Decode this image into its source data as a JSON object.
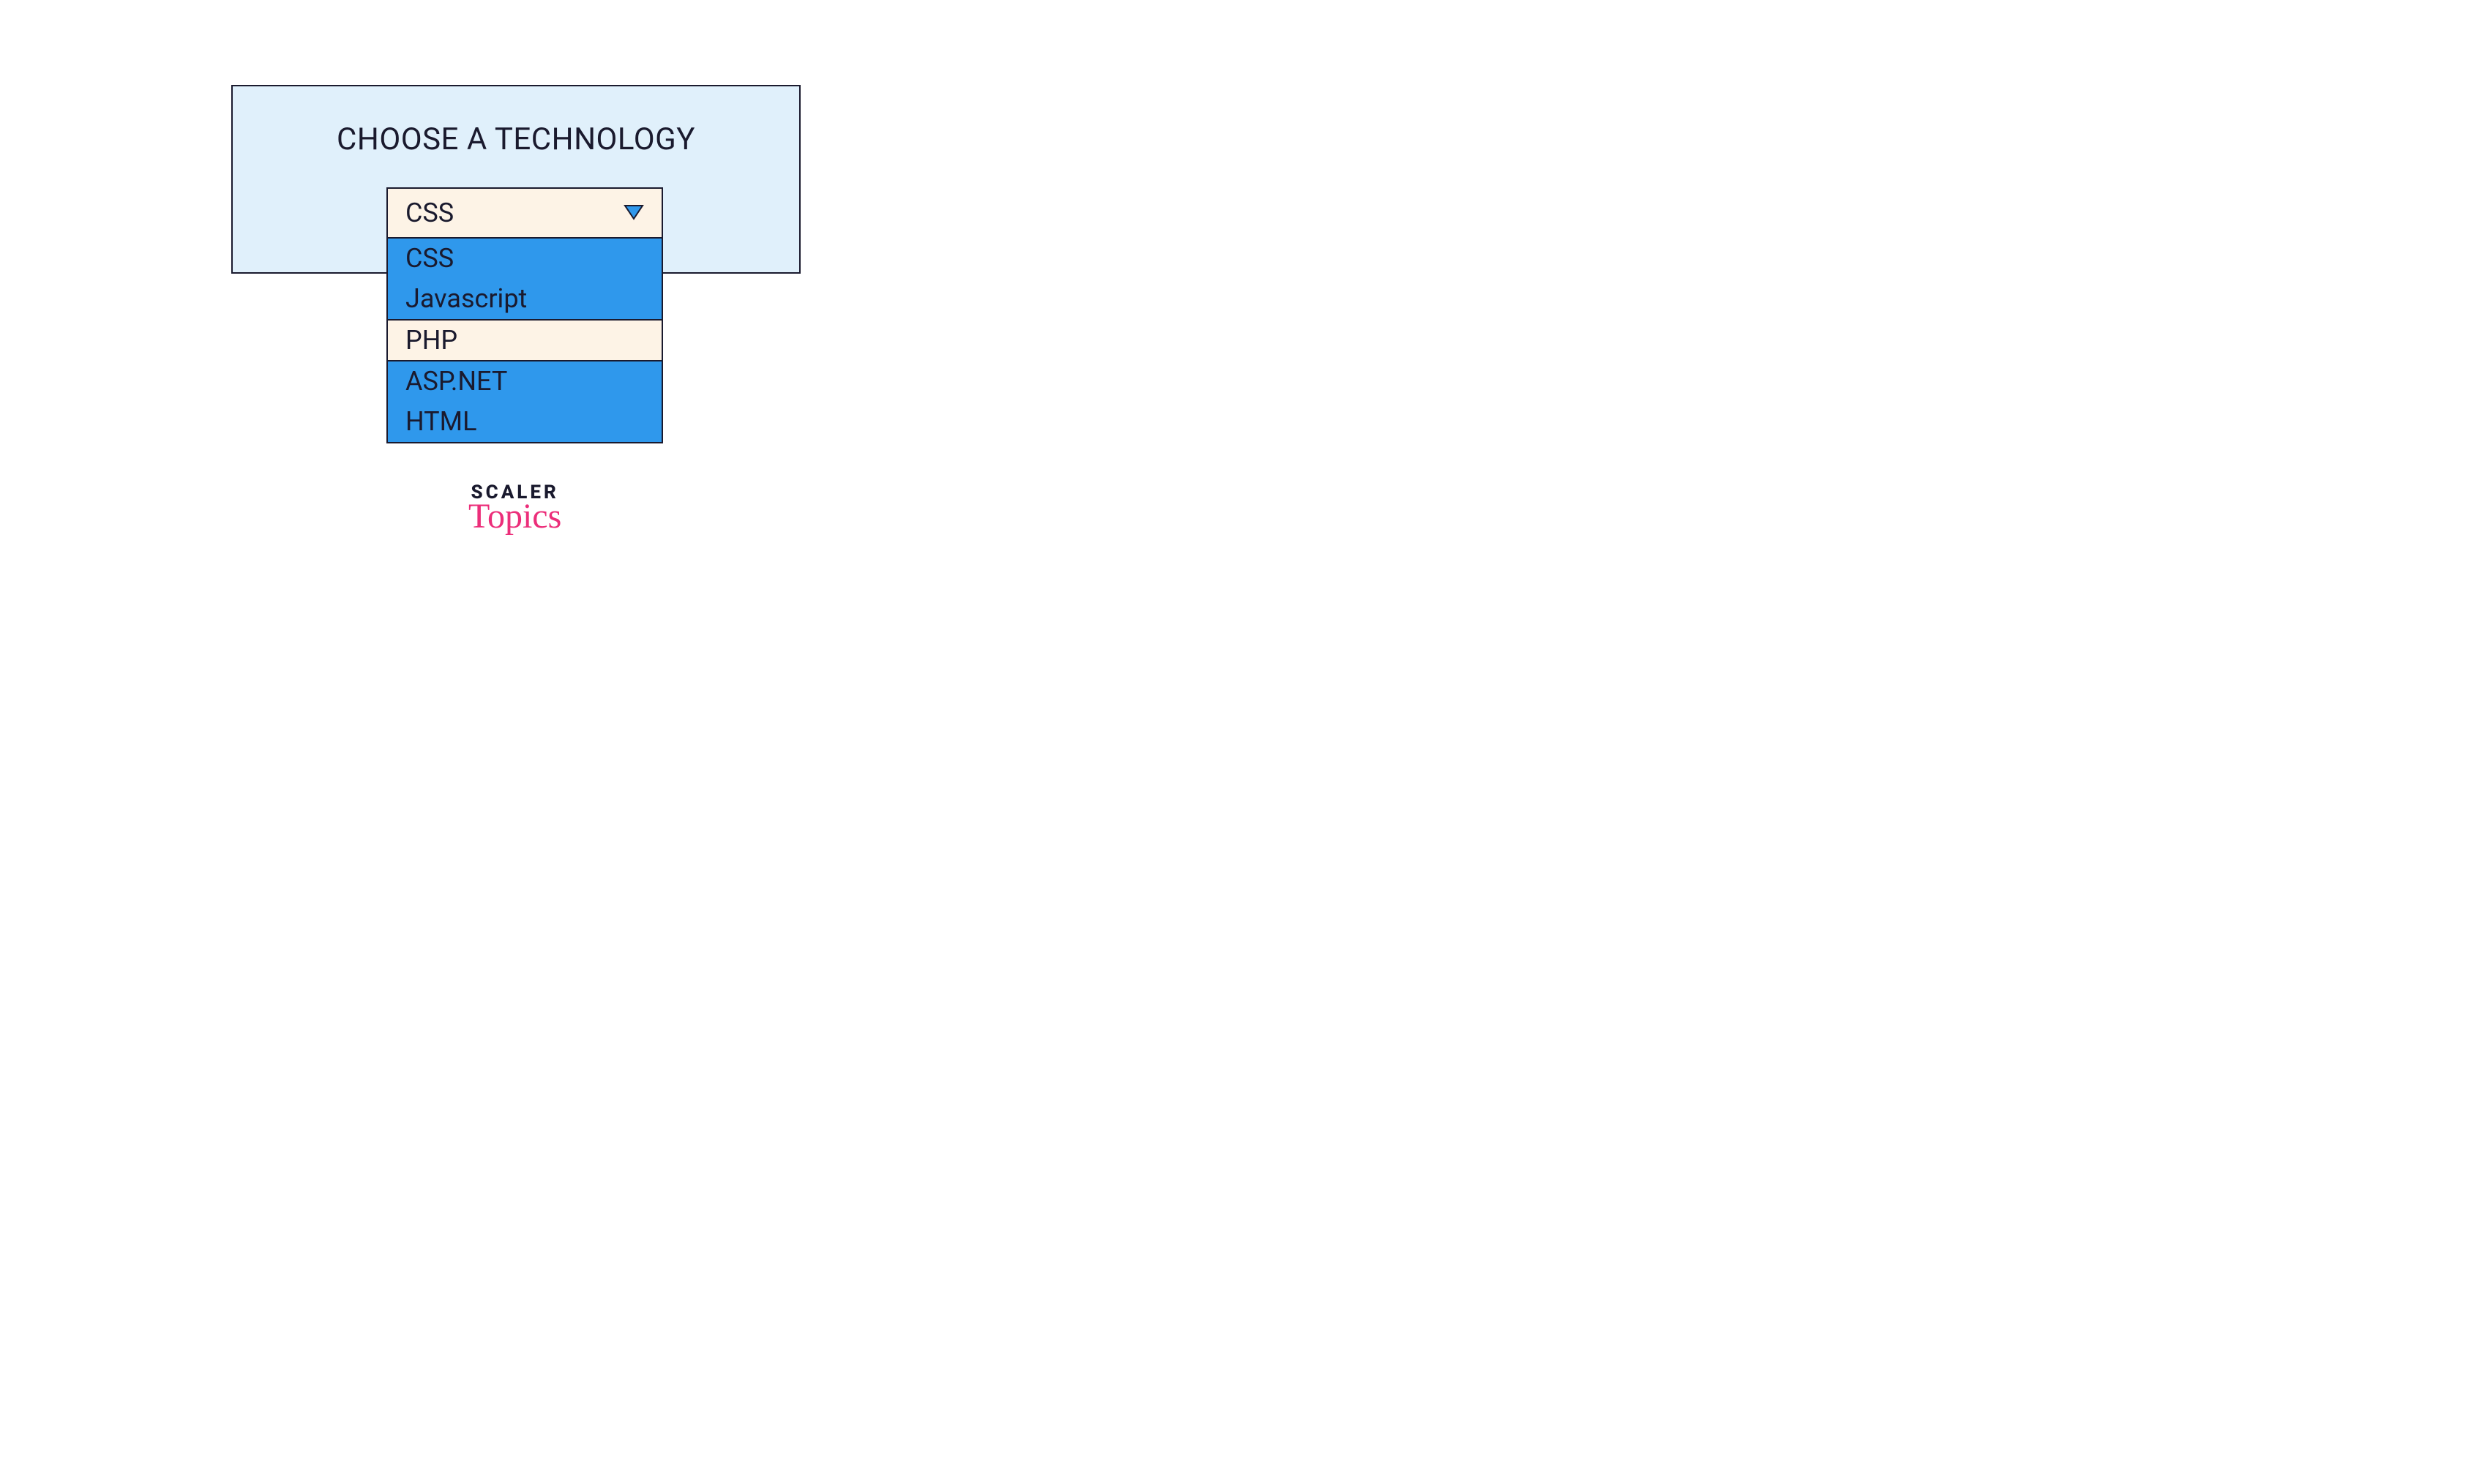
{
  "panel": {
    "title": "CHOOSE A TECHNOLOGY"
  },
  "dropdown": {
    "selected": "CSS",
    "options": [
      {
        "label": "CSS",
        "hovered": false
      },
      {
        "label": "Javascript",
        "hovered": false
      },
      {
        "label": "PHP",
        "hovered": true
      },
      {
        "label": "ASP.NET",
        "hovered": false
      },
      {
        "label": "HTML",
        "hovered": false
      }
    ]
  },
  "logo": {
    "line1": "SCALER",
    "line2": "Topics"
  },
  "colors": {
    "panel_bg": "#e0f0fb",
    "option_bg": "#2f98ec",
    "selected_bg": "#fdf3e6",
    "border": "#1a1a2e",
    "logo_accent": "#ec2e7a"
  }
}
